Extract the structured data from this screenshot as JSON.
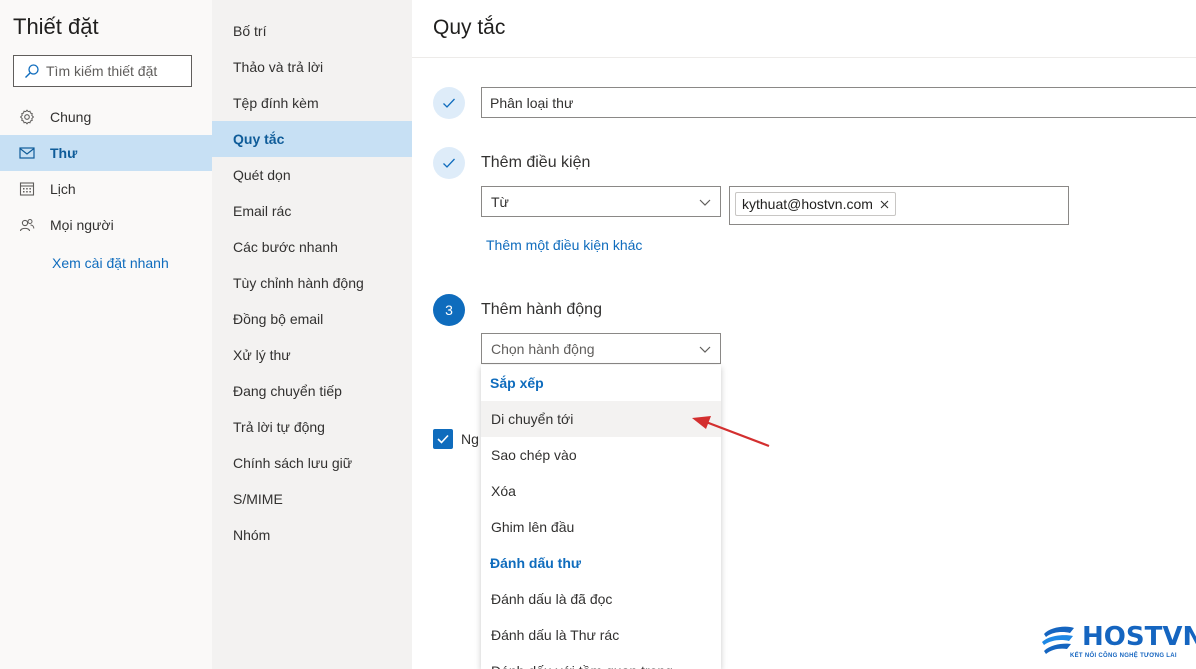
{
  "settings": {
    "title": "Thiết đặt",
    "search_placeholder": "Tìm kiếm thiết đặt"
  },
  "nav": {
    "items": [
      {
        "label": "Chung",
        "icon": "gear-icon"
      },
      {
        "label": "Thư",
        "icon": "mail-icon",
        "active": true
      },
      {
        "label": "Lịch",
        "icon": "calendar-icon"
      },
      {
        "label": "Mọi người",
        "icon": "people-icon"
      }
    ],
    "quick_link": "Xem cài đặt nhanh"
  },
  "subnav": {
    "items": [
      "Bố trí",
      "Thảo và trả lời",
      "Tệp đính kèm",
      "Quy tắc",
      "Quét dọn",
      "Email rác",
      "Các bước nhanh",
      "Tùy chỉnh hành động",
      "Đồng bộ email",
      "Xử lý thư",
      "Đang chuyển tiếp",
      "Trả lời tự động",
      "Chính sách lưu giữ",
      "S/MIME",
      "Nhóm"
    ],
    "active_index": 3
  },
  "rule": {
    "page_title": "Quy tắc",
    "name_value": "Phân loại thư",
    "condition": {
      "label": "Thêm điều kiện",
      "selected": "Từ",
      "chip": "kythuat@hostvn.com",
      "add_another": "Thêm một điều kiện khác"
    },
    "action": {
      "step_number": "3",
      "label": "Thêm hành động",
      "placeholder": "Chọn hành động",
      "menu": [
        {
          "type": "header",
          "label": "Sắp xếp"
        },
        {
          "type": "item",
          "label": "Di chuyển tới",
          "hover": true
        },
        {
          "type": "item",
          "label": "Sao chép vào"
        },
        {
          "type": "item",
          "label": "Xóa"
        },
        {
          "type": "item",
          "label": "Ghim lên đầu"
        },
        {
          "type": "header",
          "label": "Đánh dấu thư"
        },
        {
          "type": "item",
          "label": "Đánh dấu là đã đọc"
        },
        {
          "type": "item",
          "label": "Đánh dấu là Thư rác"
        },
        {
          "type": "item",
          "label": "Đánh dấu với tầm quan trọng"
        }
      ]
    },
    "checkbox_label": "Ng"
  },
  "logo": {
    "name": "HOSTVN",
    "tagline": "KẾT NỐI CÔNG NGHỆ TƯƠNG LAI"
  },
  "colors": {
    "accent": "#0f6cbd",
    "selected_bg": "#c7e0f4",
    "annotation_arrow": "#d32f2f"
  }
}
